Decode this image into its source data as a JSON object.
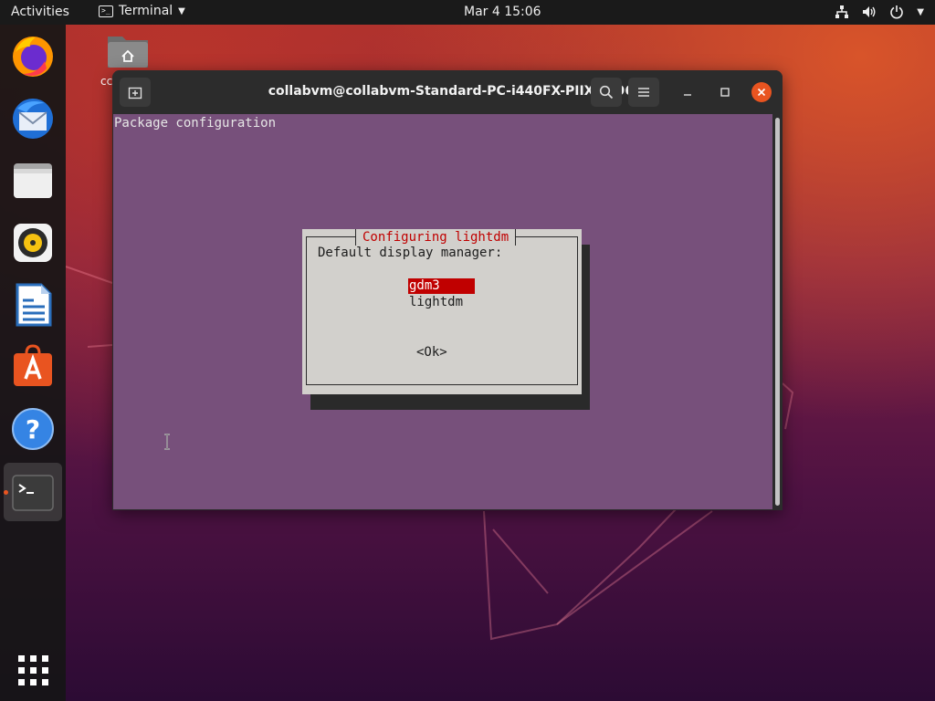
{
  "topbar": {
    "activities": "Activities",
    "app_name": "Terminal",
    "clock": "Mar 4  15:06",
    "tray_icons": [
      "network-icon",
      "volume-icon",
      "power-icon",
      "chevron-down-icon"
    ]
  },
  "dock": {
    "items": [
      "firefox-icon",
      "thunderbird-icon",
      "files-icon",
      "rhythmbox-icon",
      "libreoffice-writer-icon",
      "ubuntu-software-icon",
      "help-icon",
      "terminal-icon"
    ],
    "show_apps": "show-applications-icon",
    "active_item": "terminal-icon"
  },
  "desktop": {
    "home_label": "cc"
  },
  "window": {
    "title": "collabvm@collabvm-Standard-PC-i440FX-PIIX-1996: ~"
  },
  "terminal": {
    "header_text": "Package configuration",
    "dialog": {
      "title": "Configuring lightdm",
      "prompt": "Default display manager:",
      "options": [
        "gdm3",
        "lightdm"
      ],
      "selected": "gdm3",
      "ok_label": "<Ok>"
    }
  },
  "colors": {
    "accent": "#e95420",
    "terminal_bg": "#77507b",
    "dialog_bg": "#d2d0cc",
    "highlight": "#c00000"
  }
}
